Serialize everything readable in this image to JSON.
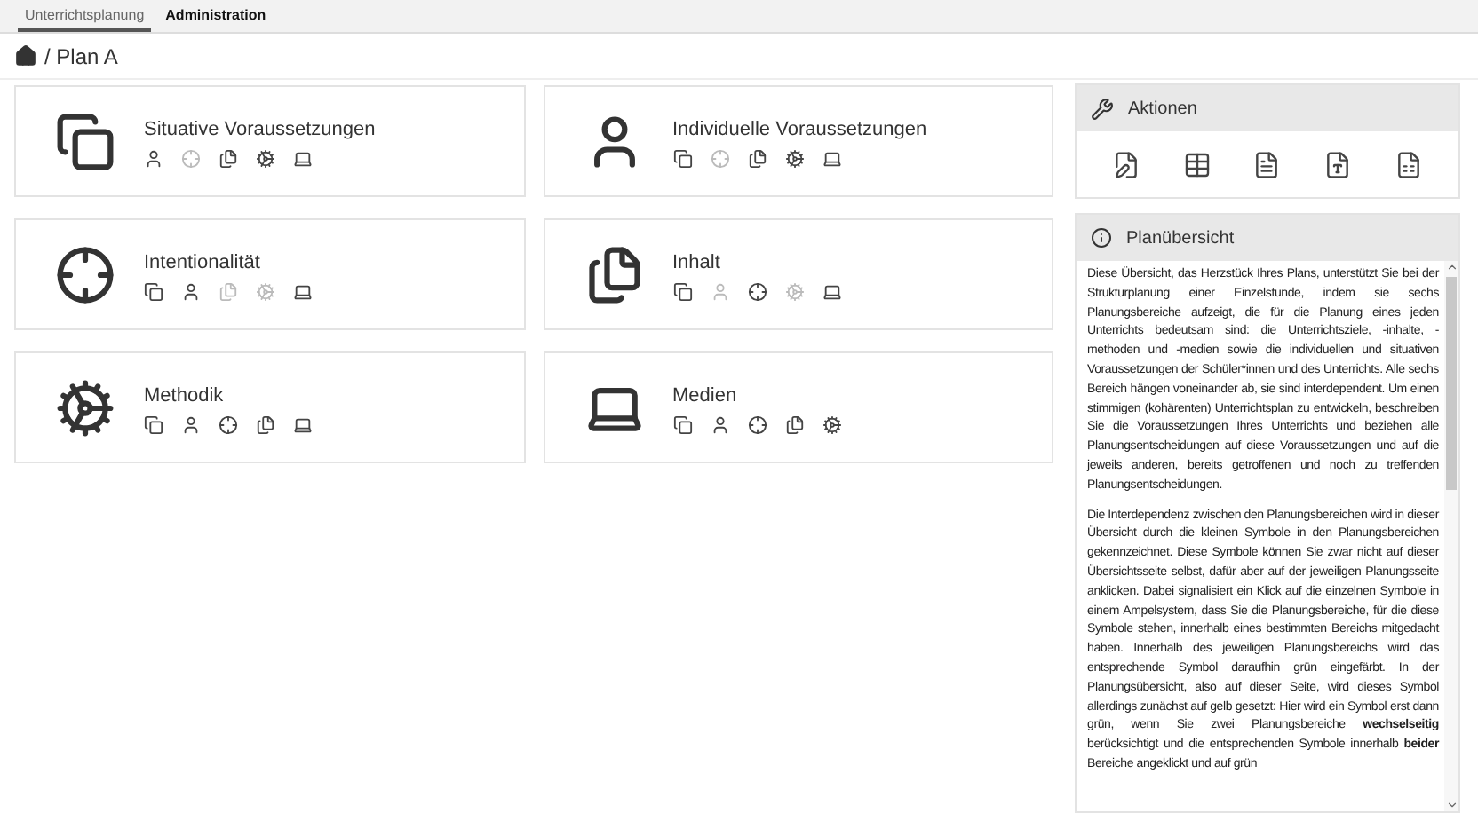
{
  "tabs": [
    {
      "label": "Unterrichtsplanung",
      "selected": true
    },
    {
      "label": "Administration",
      "selected": false
    }
  ],
  "breadcrumb": {
    "current": "/ Plan A"
  },
  "cards": [
    {
      "title": "Situative Voraussetzungen",
      "kind": "squares",
      "links": [
        {
          "kind": "person",
          "active": true
        },
        {
          "kind": "target",
          "active": false
        },
        {
          "kind": "documents",
          "active": true
        },
        {
          "kind": "gears",
          "active": true
        },
        {
          "kind": "laptop",
          "active": true
        }
      ]
    },
    {
      "title": "Individuelle Voraussetzungen",
      "kind": "person",
      "links": [
        {
          "kind": "squares",
          "active": true
        },
        {
          "kind": "target",
          "active": false
        },
        {
          "kind": "documents",
          "active": true
        },
        {
          "kind": "gears",
          "active": true
        },
        {
          "kind": "laptop",
          "active": true
        }
      ]
    },
    {
      "title": "Intentionalität",
      "kind": "target",
      "links": [
        {
          "kind": "squares",
          "active": true
        },
        {
          "kind": "person",
          "active": true
        },
        {
          "kind": "documents",
          "active": false
        },
        {
          "kind": "gears",
          "active": false
        },
        {
          "kind": "laptop",
          "active": true
        }
      ]
    },
    {
      "title": "Inhalt",
      "kind": "documents",
      "links": [
        {
          "kind": "squares",
          "active": true
        },
        {
          "kind": "person",
          "active": false
        },
        {
          "kind": "target",
          "active": true
        },
        {
          "kind": "gears",
          "active": false
        },
        {
          "kind": "laptop",
          "active": true
        }
      ]
    },
    {
      "title": "Methodik",
      "kind": "gears",
      "links": [
        {
          "kind": "squares",
          "active": true
        },
        {
          "kind": "person",
          "active": true
        },
        {
          "kind": "target",
          "active": true
        },
        {
          "kind": "documents",
          "active": true
        },
        {
          "kind": "laptop",
          "active": true
        }
      ]
    },
    {
      "title": "Medien",
      "kind": "laptop",
      "links": [
        {
          "kind": "squares",
          "active": true
        },
        {
          "kind": "person",
          "active": true
        },
        {
          "kind": "target",
          "active": true
        },
        {
          "kind": "documents",
          "active": true
        },
        {
          "kind": "gears",
          "active": true
        }
      ]
    }
  ],
  "actions": {
    "title": "Aktionen",
    "items": [
      {
        "kind": "edit"
      },
      {
        "kind": "table"
      },
      {
        "kind": "pdf"
      },
      {
        "kind": "word"
      },
      {
        "kind": "text"
      }
    ]
  },
  "overview": {
    "title": "Planübersicht",
    "paragraphs": [
      "Diese Übersicht, das Herzstück Ihres Plans, unterstützt Sie bei der Strukturplanung einer Einzelstunde, indem sie sechs Planungsbereiche aufzeigt, die für die Planung eines jeden Unterrichts bedeutsam sind: die Unterrichtsziele, -inhalte, -methoden und -medien sowie die individuellen und situativen Voraussetzungen der Schüler*innen und des Unterrichts. Alle sechs Bereich hängen voneinander ab, sie sind interdependent. Um einen stimmigen (kohärenten) Unterrichtsplan zu entwickeln, beschreiben Sie die Voraussetzungen Ihres Unterrichts und beziehen alle Planungsentscheidungen auf diese Voraussetzungen und auf die jeweils anderen, bereits getroffenen und noch zu treffenden Planungsentscheidungen.",
      "Die Interdependenz zwischen den Planungsbereichen wird in dieser Übersicht durch die kleinen Symbole in den Planungsbereichen gekennzeichnet. Diese Symbole können Sie zwar nicht auf dieser Übersichtsseite selbst, dafür aber auf der jeweiligen Planungsseite anklicken. Dabei signalisiert ein Klick auf die einzelnen Symbole in einem Ampelsystem, dass Sie die Planungsbereiche, für die diese Symbole stehen, innerhalb eines bestimmten Bereichs mitgedacht haben. Innerhalb des jeweiligen Planungsbereichs wird das entsprechende Symbol daraufhin grün eingefärbt. In der Planungsübersicht, also auf dieser Seite, wird dieses Symbol allerdings zunächst auf gelb gesetzt: Hier wird ein Symbol erst dann grün, wenn Sie zwei Planungsbereiche **wechselseitig** berücksichtigt und die entsprechenden Symbole innerhalb **beider** Bereiche angeklickt und auf grün"
    ]
  }
}
